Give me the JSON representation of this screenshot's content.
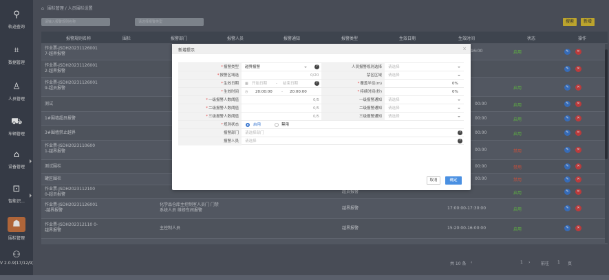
{
  "sidebar": {
    "items": [
      {
        "label": "轨迹查询",
        "icon": "location-icon"
      },
      {
        "label": "数据管理",
        "icon": "data-icon"
      },
      {
        "label": "人员管理",
        "icon": "person-icon"
      },
      {
        "label": "车辆管理",
        "icon": "vehicle-icon"
      },
      {
        "label": "设备管理",
        "icon": "device-icon"
      },
      {
        "label": "智能识...",
        "icon": "recognition-icon"
      },
      {
        "label": "围栏管理",
        "icon": "fence-icon"
      },
      {
        "label": "V 2.0.9(17/12/9)",
        "icon": "version-icon"
      }
    ]
  },
  "breadcrumb": {
    "part1": "围栏管理",
    "sep": "/",
    "part2": "人员围栏设置"
  },
  "toolbar": {
    "search1_placeholder": "请输入报警规则名称",
    "search2_placeholder": "请选择报警类型",
    "search_label": "搜索",
    "add_label": "新增"
  },
  "table": {
    "headers": [
      "报警规则名称",
      "围栏",
      "报警部门",
      "报警人员",
      "报警通知",
      "报警类型",
      "生效日期",
      "生效时间",
      "状态",
      "操作"
    ],
    "rows": [
      {
        "name": "作业票-JSDH20231126001 7-越界报警",
        "dept": "",
        "type": "",
        "time": "16:00",
        "status": "启用"
      },
      {
        "name": "作业票-JSDH20231126001 2-越界报警",
        "dept": "",
        "type": "",
        "time": "",
        "status": ""
      },
      {
        "name": "作业票-JSDH20231126001 9-超员报警",
        "dept": "",
        "type": "",
        "time": "",
        "status": "启用"
      },
      {
        "name": "测试",
        "dept": "",
        "type": "",
        "time": "00:00",
        "status": "启用"
      },
      {
        "name": "1#围墙超员报警",
        "dept": "",
        "type": "",
        "time": "00:00",
        "status": "启用"
      },
      {
        "name": "3#围墙禁止越界",
        "dept": "",
        "type": "",
        "time": "00:00",
        "status": "启用"
      },
      {
        "name": "作业票-JSDH2023110600 1-越界报警",
        "dept": "",
        "type": "",
        "time": "00:00",
        "status": "禁用"
      },
      {
        "name": "测试围栏",
        "dept": "",
        "type": "",
        "time": "00:00",
        "status": "禁用"
      },
      {
        "name": "罐区围栏",
        "dept": "",
        "type": "",
        "time": "00:00",
        "status": "禁用"
      },
      {
        "name": "作业票-JSDH2023112100 0-超员报警",
        "dept": "",
        "type": "超员报警",
        "time": "",
        "status": "启用"
      },
      {
        "name": "作业票-JSDH20231126001 -越界报警",
        "dept": "化学品仓库主控制室人员门 门禁系统人员 维修车间报警",
        "type": "越界报警",
        "time": "17:00:00-17:30:00",
        "status": "启用"
      },
      {
        "name": "作业票-JSDH202312110 0-越界报警",
        "dept": "主控制人员",
        "type": "越界报警",
        "time": "15:20:00-16:00:00",
        "status": "启用"
      }
    ]
  },
  "pager": {
    "total": "共 10 条",
    "page": "1",
    "goto": "前往",
    "page_input": "1",
    "unit": "页"
  },
  "dialog": {
    "title": "新增提示",
    "close": "×",
    "fields": {
      "alarm_type_label": "报警类型",
      "alarm_type_value": "越界报警",
      "person_label": "人员报警规则选择",
      "person_ph": "请选择",
      "fence_label": "报警区域选",
      "fence_value": "",
      "fence_count": "0/20",
      "fence2_label": "禁区区域",
      "fence2_ph": "请选择",
      "date_label": "生效日期",
      "date_start_ph": "开始日期",
      "date_sep": "-",
      "date_end_ph": "结束日期",
      "radius_label": "覆盖半径(m)",
      "radius_value": "0%",
      "time_label": "生效时间",
      "time_start": "20:00:00",
      "time_sep": "-",
      "time_end": "20:00:00",
      "duration_label": "持续时间(秒)",
      "duration_value": "0%",
      "lvl1_label": "一级报警人数阈值",
      "lvl1_value": "0/5",
      "lvl1_mode_label": "一级报警通知",
      "lvl1_mode_ph": "请选择",
      "lvl2_label": "二级报警人数阈值",
      "lvl2_value": "0/5",
      "lvl2_mode_label": "二级报警通知",
      "lvl2_mode_ph": "请选择",
      "lvl3_label": "三级报警人数阈值",
      "lvl3_value": "0/5",
      "lvl3_mode_label": "三级报警通知",
      "lvl3_mode_ph": "请选择",
      "status_label": "规则状态",
      "status_on": "启用",
      "status_off": "禁用",
      "dept_label": "报警部门",
      "dept_ph": "请选择部门",
      "people_label": "报警人员",
      "people_ph": "请选择"
    },
    "cancel": "取消",
    "ok": "确定"
  }
}
